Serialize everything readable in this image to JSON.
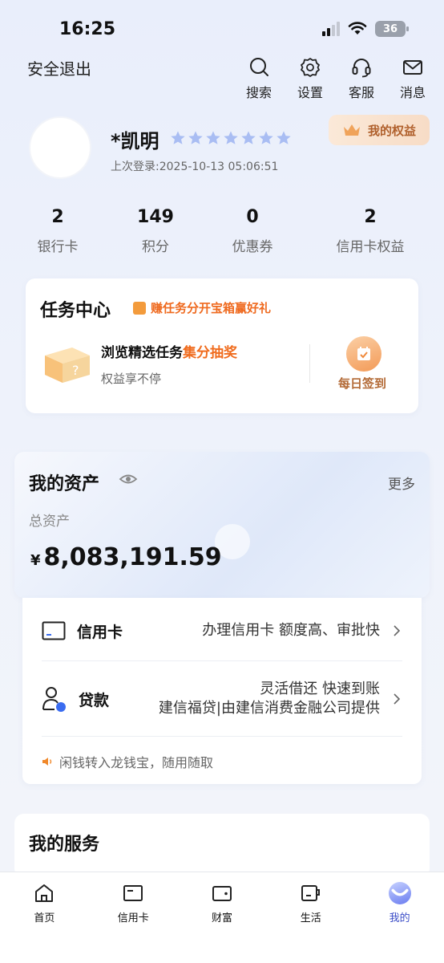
{
  "status_bar": {
    "time": "16:25",
    "battery": "36"
  },
  "header": {
    "logout": "安全退出",
    "actions": [
      {
        "label": "搜索",
        "icon": "search-icon"
      },
      {
        "label": "设置",
        "icon": "gear-icon"
      },
      {
        "label": "客服",
        "icon": "headset-icon"
      },
      {
        "label": "消息",
        "icon": "mail-icon"
      }
    ]
  },
  "profile": {
    "name": "*凯明",
    "star_count": 7,
    "last_login": "上次登录:2025-10-13 05:06:51",
    "rights_badge": "我的权益"
  },
  "stats": [
    {
      "value": "2",
      "label": "银行卡"
    },
    {
      "value": "149",
      "label": "积分"
    },
    {
      "value": "0",
      "label": "优惠券"
    },
    {
      "value": "2",
      "label": "信用卡权益"
    }
  ],
  "task_center": {
    "title": "任务中心",
    "promo": "赚任务分开宝箱赢好礼",
    "line1_prefix": "浏览精选任务",
    "line1_highlight": "集分抽奖",
    "line2": "权益享不停",
    "checkin_label": "每日签到"
  },
  "assets": {
    "title": "我的资产",
    "more": "更多",
    "total_label": "总资产",
    "currency": "¥",
    "total_value": "8,083,191.59"
  },
  "services": {
    "credit_card": {
      "name": "信用卡",
      "desc": "办理信用卡 额度高、审批快"
    },
    "loan": {
      "name": "贷款",
      "desc_line1": "灵活借还 快速到账",
      "desc_line2": "建信福贷|由建信消费金融公司提供"
    },
    "notice": "闲钱转入龙钱宝，随用随取"
  },
  "my_services": {
    "title": "我的服务"
  },
  "tabbar": [
    {
      "label": "首页",
      "icon": "home-icon"
    },
    {
      "label": "信用卡",
      "icon": "credit-card-icon"
    },
    {
      "label": "财富",
      "icon": "wallet-icon"
    },
    {
      "label": "生活",
      "icon": "cup-icon"
    },
    {
      "label": "我的",
      "icon": "me-icon",
      "active": true
    }
  ],
  "colors": {
    "accent": "#3a4cc7",
    "highlight": "#f06c1e",
    "badge_text": "#b0602c"
  }
}
